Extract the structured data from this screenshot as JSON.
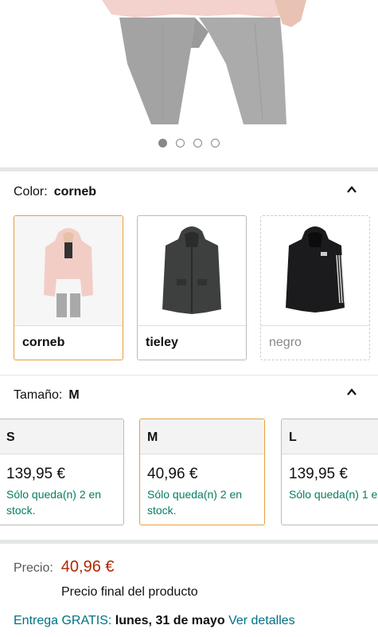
{
  "carousel": {
    "dots": [
      true,
      false,
      false,
      false
    ]
  },
  "color": {
    "label": "Color:",
    "value": "corneb",
    "options": [
      {
        "label": "corneb",
        "selected": true,
        "available": true
      },
      {
        "label": "tieley",
        "selected": false,
        "available": true
      },
      {
        "label": "negro",
        "selected": false,
        "available": false
      }
    ]
  },
  "size": {
    "label": "Tamaño:",
    "value": "M",
    "options": [
      {
        "label": "S",
        "price": "139,95 €",
        "stock": "Sólo queda(n) 2 en stock."
      },
      {
        "label": "M",
        "price": "40,96 €",
        "stock": "Sólo queda(n) 2 en stock."
      },
      {
        "label": "L",
        "price": "139,95 €",
        "stock": "Sólo queda(n) 1 e"
      }
    ]
  },
  "pricing": {
    "label": "Precio:",
    "value": "40,96 €",
    "note": "Precio final del producto"
  },
  "delivery": {
    "prefix": "Entrega GRATIS:",
    "date": "lunes, 31 de mayo",
    "link": "Ver detalles"
  },
  "colors": {
    "accent": "#e7a03c",
    "price": "#b12704",
    "stock": "#067d62",
    "link": "#007185"
  }
}
